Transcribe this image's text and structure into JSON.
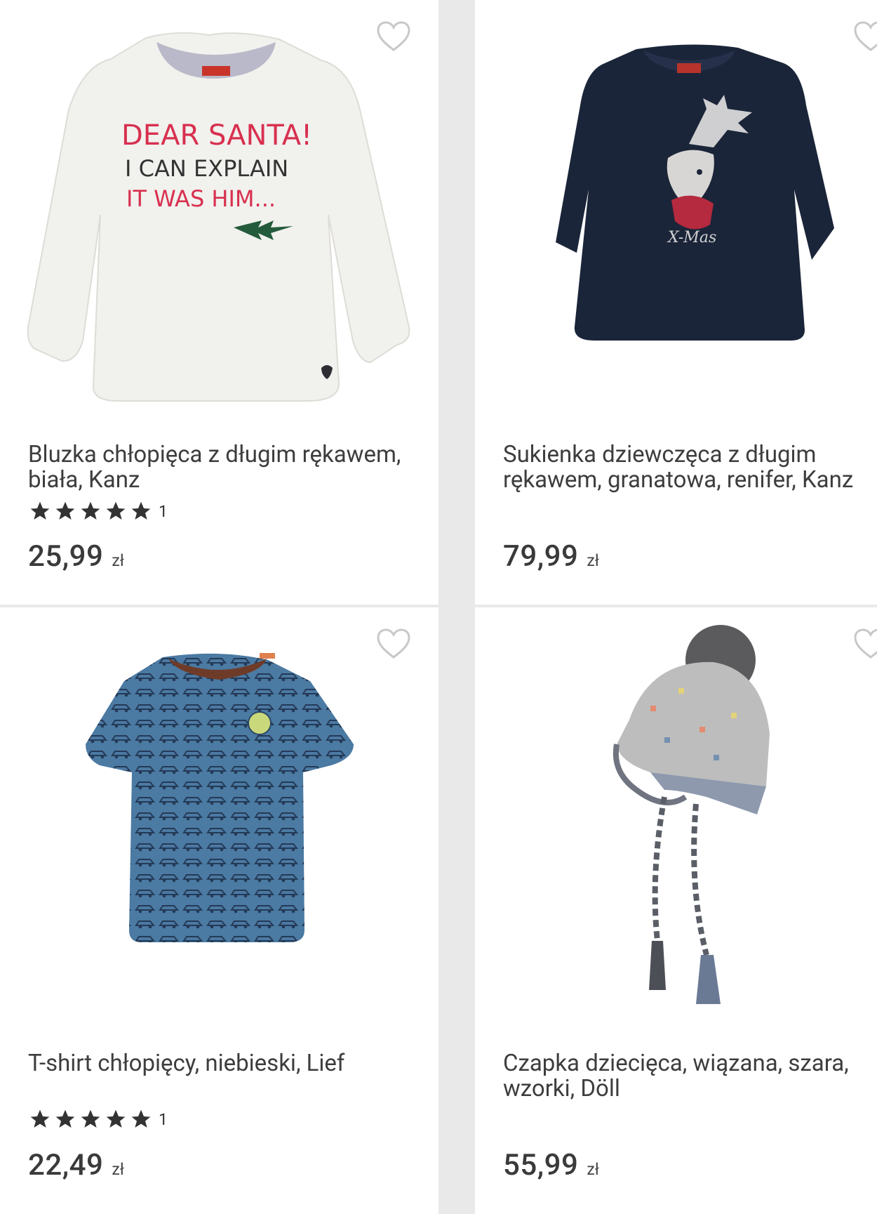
{
  "products": [
    {
      "title": "Bluzka chłopięca z długim rękawem, biała, Kanz",
      "rating_count": "1",
      "stars": 5,
      "price": "25,99",
      "currency": "zł",
      "shirt_text": [
        "DEAR SANTA!",
        "I CAN EXPLAIN",
        "IT WAS HIM..."
      ],
      "image": "white-long-sleeve-shirt"
    },
    {
      "title": "Sukienka dziewczęca z długim rękawem, granatowa, renifer, Kanz",
      "price": "79,99",
      "currency": "zł",
      "dress_text": "X-Mas",
      "image": "navy-reindeer-dress"
    },
    {
      "title": "T-shirt chłopięcy, niebieski, Lief",
      "rating_count": "1",
      "stars": 5,
      "price": "22,49",
      "currency": "zł",
      "image": "blue-car-print-tshirt"
    },
    {
      "title": "Czapka dziecięca, wiązana, szara, wzorki, Döll",
      "price": "55,99",
      "currency": "zł",
      "image": "grey-knit-pompom-hat"
    }
  ]
}
